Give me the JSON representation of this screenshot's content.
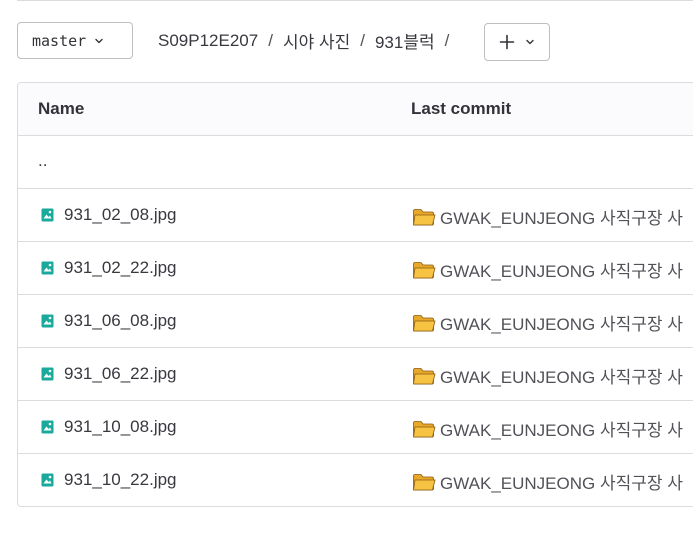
{
  "branch": {
    "label": "master"
  },
  "breadcrumb": {
    "items": [
      "S09P12E207",
      "시야 사진",
      "931블럭"
    ],
    "separator": "/"
  },
  "table": {
    "columns": [
      "Name",
      "Last commit"
    ],
    "parent_row": "..",
    "rows": [
      {
        "name": "931_02_08.jpg",
        "commit": "GWAK_EUNJEONG 사직구장 사"
      },
      {
        "name": "931_02_22.jpg",
        "commit": "GWAK_EUNJEONG 사직구장 사"
      },
      {
        "name": "931_06_08.jpg",
        "commit": "GWAK_EUNJEONG 사직구장 사"
      },
      {
        "name": "931_06_22.jpg",
        "commit": "GWAK_EUNJEONG 사직구장 사"
      },
      {
        "name": "931_10_08.jpg",
        "commit": "GWAK_EUNJEONG 사직구장 사"
      },
      {
        "name": "931_10_22.jpg",
        "commit": "GWAK_EUNJEONG 사직구장 사"
      }
    ]
  },
  "icons": {
    "file": "image-file-icon",
    "folder": "folder-emoji-icon",
    "chevron": "chevron-down-icon",
    "plus": "plus-icon"
  },
  "colors": {
    "file_icon": "#1aaa9b",
    "folder_fill": "#f6c342",
    "border": "#dcdcde"
  }
}
